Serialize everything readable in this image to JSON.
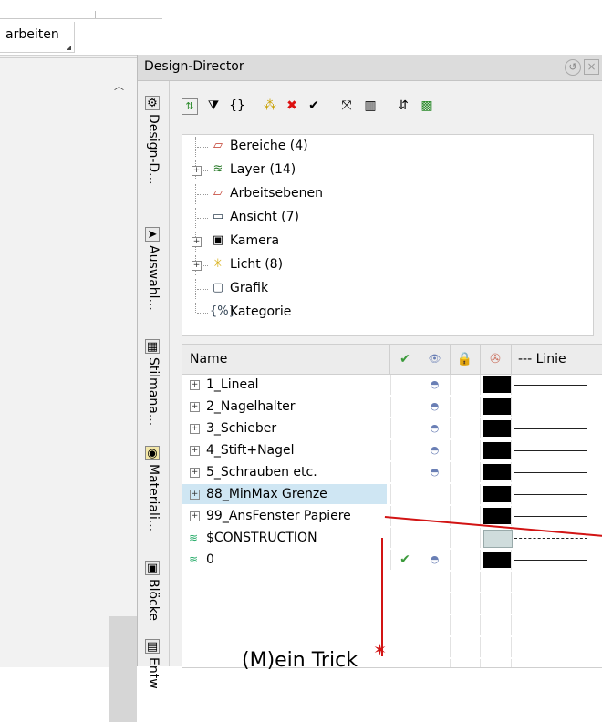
{
  "ribbon": {
    "tab_label": "arbeiten"
  },
  "panel": {
    "title": "Design-Director",
    "vertical_tabs": [
      {
        "label": "Design-D...",
        "icon": "design-director-icon"
      },
      {
        "label": "Auswahl...",
        "icon": "selection-arrow-icon"
      },
      {
        "label": "Stilmana...",
        "icon": "style-manager-icon"
      },
      {
        "label": "Materiali...",
        "icon": "material-icon"
      },
      {
        "label": "Blöcke",
        "icon": "blocks-icon"
      },
      {
        "label": "Entw",
        "icon": "draft-icon"
      }
    ],
    "tree": [
      {
        "label": "Bereiche (4)",
        "expandable": false,
        "icon": "area-icon"
      },
      {
        "label": "Layer (14)",
        "expandable": true,
        "icon": "layer-icon"
      },
      {
        "label": "Arbeitsebenen",
        "expandable": false,
        "icon": "workplane-icon"
      },
      {
        "label": "Ansicht (7)",
        "expandable": false,
        "icon": "view-icon"
      },
      {
        "label": "Kamera",
        "expandable": true,
        "icon": "camera-icon"
      },
      {
        "label": "Licht (8)",
        "expandable": true,
        "icon": "light-icon"
      },
      {
        "label": "Grafik",
        "expandable": false,
        "icon": "graphic-icon"
      },
      {
        "label": "Kategorie",
        "expandable": false,
        "icon": "category-icon"
      }
    ],
    "table": {
      "columns": {
        "name": "Name",
        "line": "--- Linie"
      },
      "rows": [
        {
          "name": "1_Lineal",
          "expandable": true,
          "active": false,
          "visible": true,
          "color": "#000000"
        },
        {
          "name": "2_Nagelhalter",
          "expandable": true,
          "active": false,
          "visible": true,
          "color": "#000000"
        },
        {
          "name": "3_Schieber",
          "expandable": true,
          "active": false,
          "visible": true,
          "color": "#000000"
        },
        {
          "name": "4_Stift+Nagel",
          "expandable": true,
          "active": false,
          "visible": true,
          "color": "#000000"
        },
        {
          "name": "5_Schrauben etc.",
          "expandable": true,
          "active": false,
          "visible": true,
          "color": "#000000"
        },
        {
          "name": "88_MinMax Grenze",
          "expandable": true,
          "active": false,
          "visible": false,
          "color": "#000000",
          "selected": true
        },
        {
          "name": "99_AnsFenster Papiere",
          "expandable": true,
          "active": false,
          "visible": false,
          "color": "#000000"
        },
        {
          "name": "$CONSTRUCTION",
          "expandable": false,
          "active": false,
          "visible": false,
          "color": "#cfdcdc"
        },
        {
          "name": "0",
          "expandable": false,
          "active": true,
          "visible": true,
          "color": "#000000"
        }
      ]
    }
  },
  "annotation": {
    "text": "(M)ein Trick",
    "color": "#d21414"
  }
}
